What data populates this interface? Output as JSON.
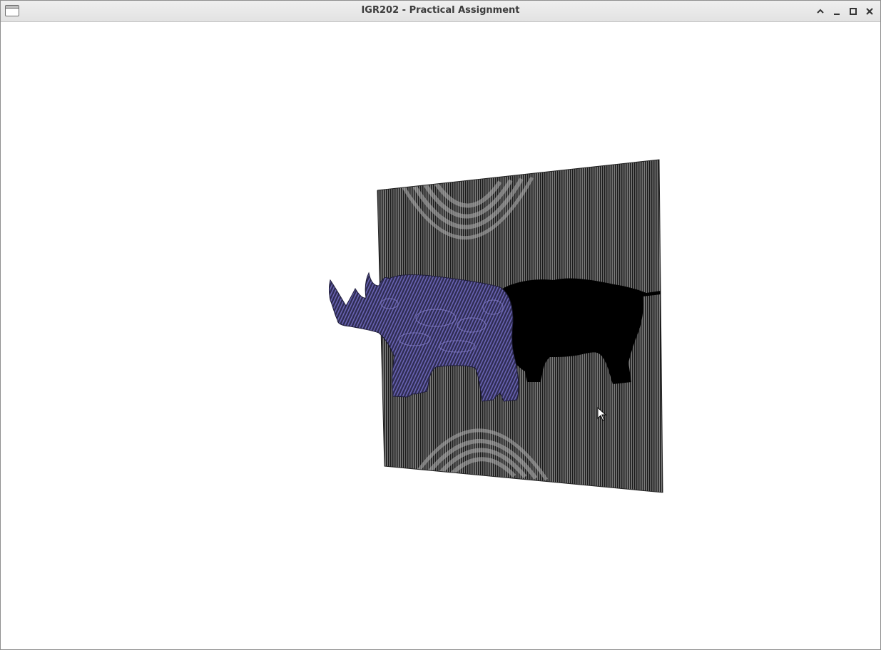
{
  "window": {
    "title": "IGR202 - Practical Assignment",
    "controls": [
      "shade",
      "minimize",
      "maximize",
      "close"
    ]
  },
  "icons": {
    "app": "window-icon",
    "shade": "chevron-up-icon",
    "minimize": "minimize-icon",
    "maximize": "maximize-icon",
    "close": "close-icon",
    "cursor": "mouse-pointer-icon"
  },
  "scene": {
    "background_color": "#ffffff",
    "plane_color": "#7a7a7a",
    "plane_stripe_color": "#1a1a1a",
    "mesh_color": "#2e2c52",
    "mesh_highlight_color": "#6a64b4",
    "shadow_color": "#000000"
  }
}
